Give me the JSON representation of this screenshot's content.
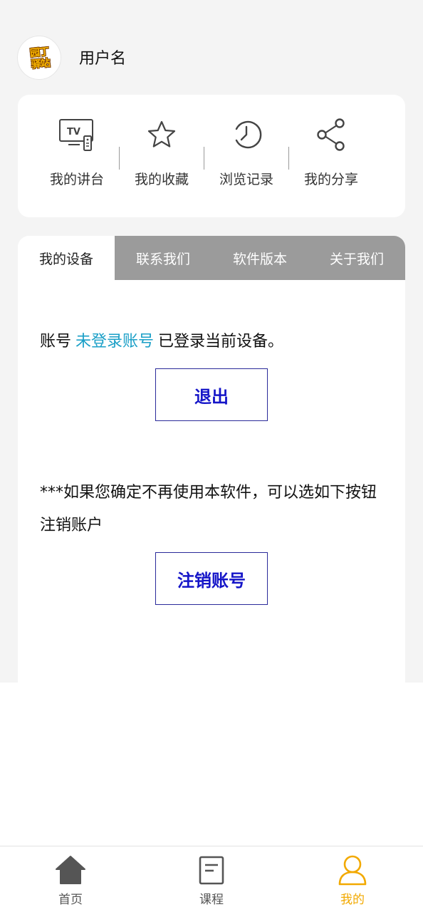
{
  "header": {
    "avatar_logo_lines": [
      "园丁",
      "驿站"
    ],
    "username": "用户名"
  },
  "quick_actions": [
    {
      "label": "我的讲台",
      "icon": "tv-remote-icon"
    },
    {
      "label": "我的收藏",
      "icon": "star-icon"
    },
    {
      "label": "浏览记录",
      "icon": "clock-history-icon"
    },
    {
      "label": "我的分享",
      "icon": "share-icon"
    }
  ],
  "tabs": [
    {
      "label": "我的设备",
      "active": true
    },
    {
      "label": "联系我们",
      "active": false
    },
    {
      "label": "软件版本",
      "active": false
    },
    {
      "label": "关于我们",
      "active": false
    }
  ],
  "device": {
    "account_prefix": "账号",
    "account_name": "未登录账号",
    "account_suffix": "已登录当前设备。",
    "logout_label": "退出",
    "notice": "***如果您确定不再使用本软件，可以选如下按钮注销账户",
    "deregister_label": "注销账号"
  },
  "bottom_nav": [
    {
      "label": "首页",
      "icon": "home-icon",
      "active": false
    },
    {
      "label": "课程",
      "icon": "document-icon",
      "active": false
    },
    {
      "label": "我的",
      "icon": "user-icon",
      "active": true
    }
  ],
  "colors": {
    "accent": "#f2a900",
    "link": "#1a9fc7",
    "button_text": "#1515c8",
    "tab_inactive": "#9b9b9b"
  }
}
